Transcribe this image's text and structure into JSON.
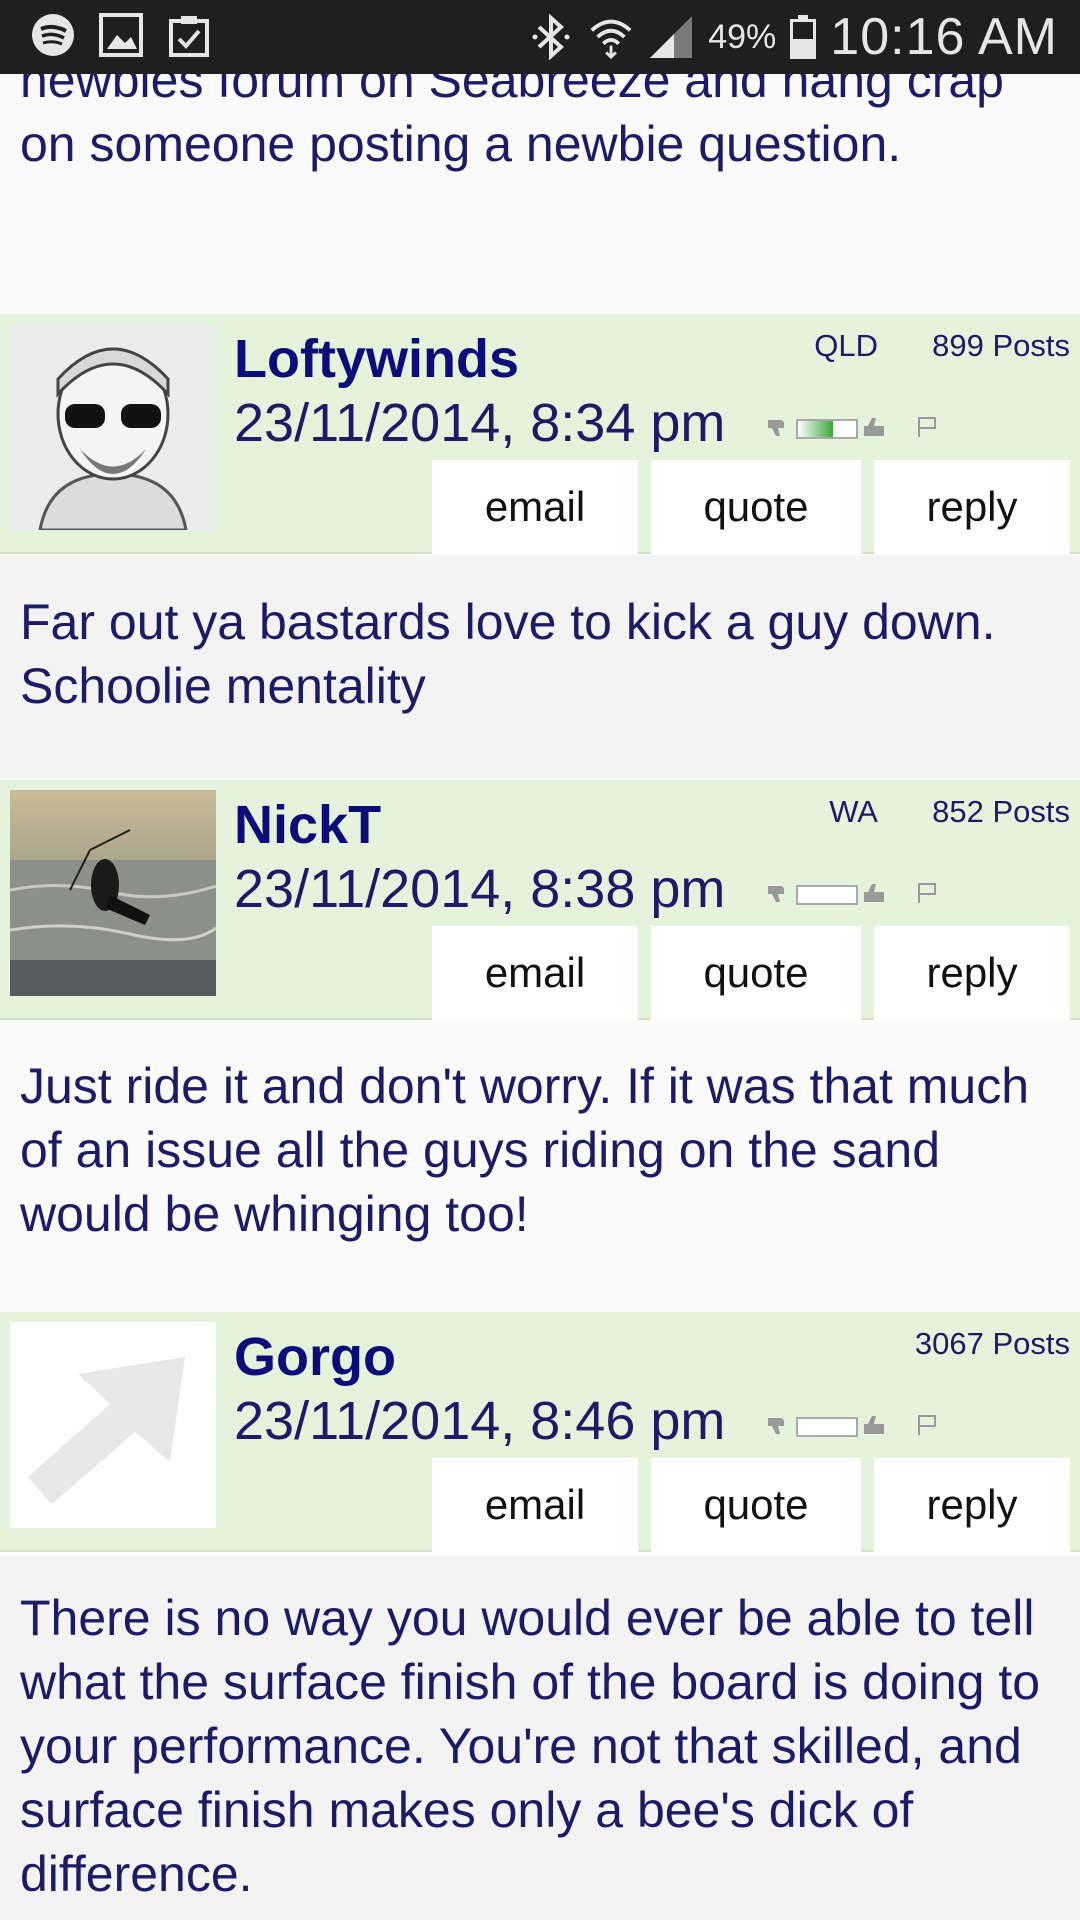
{
  "status_bar": {
    "battery": "49%",
    "time": "10:16 AM"
  },
  "prev_post": {
    "text": "newbies forum on Seabreeze and hang crap on someone posting a newbie question."
  },
  "posts": [
    {
      "username": "Loftywinds",
      "timestamp": "23/11/2014, 8:34 pm",
      "location": "QLD",
      "post_count": "899 Posts",
      "vote_level": 0.6,
      "body": "Far out ya bastards love to kick a guy down. Schoolie mentality"
    },
    {
      "username": "NickT",
      "timestamp": "23/11/2014, 8:38 pm",
      "location": "WA",
      "post_count": "852 Posts",
      "vote_level": 0,
      "body": "Just ride it and don't worry. If it was that much of an issue all the guys riding on the sand would be whinging too!"
    },
    {
      "username": "Gorgo",
      "timestamp": "23/11/2014, 8:46 pm",
      "location": "",
      "post_count": "3067 Posts",
      "vote_level": 0,
      "body": "There is no way you would ever be able to tell what the surface finish of the board is doing to your performance. You're not that skilled, and surface finish makes only a bee's dick of difference."
    }
  ],
  "buttons": {
    "email": "email",
    "quote": "quote",
    "reply": "reply"
  }
}
